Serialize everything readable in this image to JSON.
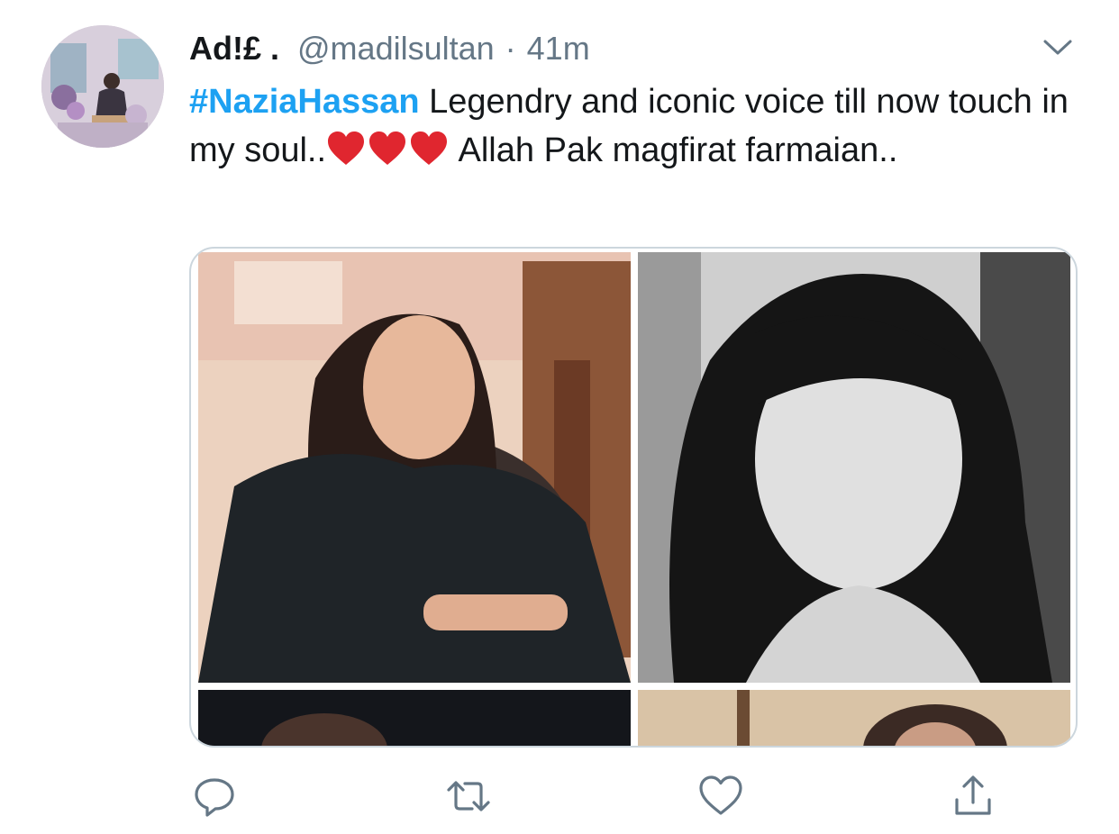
{
  "tweet": {
    "display_name": "Ad!£ .",
    "handle": "@madilsultan",
    "separator": "·",
    "time": "41m",
    "hashtag": "#NaziaHassan",
    "text_part1": " Legendry and iconic voice till now touch in my soul..",
    "text_part2": " Allah Pak magfirat farmaian..",
    "emoji": [
      "red-heart",
      "red-heart",
      "red-heart"
    ],
    "media_count": 4
  },
  "icons": {
    "caret": "chevron-down-icon",
    "reply": "reply-icon",
    "retweet": "retweet-icon",
    "like": "heart-outline-icon",
    "share": "share-icon"
  },
  "colors": {
    "link": "#1da1f2",
    "text": "#14171a",
    "secondary": "#657786",
    "heart_emoji": "#e0262f",
    "media_border": "#ccd6dd"
  }
}
